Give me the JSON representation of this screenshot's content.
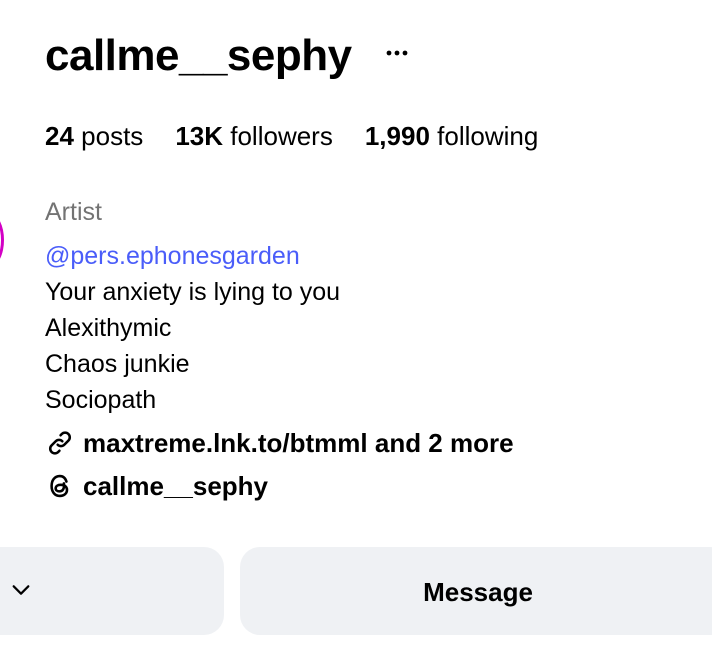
{
  "profile": {
    "username": "callme__sephy",
    "more_icon": "more-horizontal-icon"
  },
  "stats": {
    "posts_count": "24",
    "posts_label": "posts",
    "followers_count": "13K",
    "followers_label": "followers",
    "following_count": "1,990",
    "following_label": "following"
  },
  "bio": {
    "category": "Artist",
    "mention": "@pers.ephonesgarden",
    "lines": [
      "Your anxiety is lying to you",
      "Alexithymic",
      "Chaos junkie",
      "Sociopath"
    ]
  },
  "links": {
    "link_text": "maxtreme.lnk.to/btmml and 2 more",
    "link_icon": "link-icon",
    "threads_handle": "callme__sephy",
    "threads_icon": "threads-icon"
  },
  "actions": {
    "follow_chevron_icon": "chevron-down-icon",
    "message_label": "Message"
  },
  "colors": {
    "mention": "#4a5df9",
    "category": "#737373",
    "button_bg": "#eff1f4",
    "avatar_ring": "#d300c5"
  }
}
